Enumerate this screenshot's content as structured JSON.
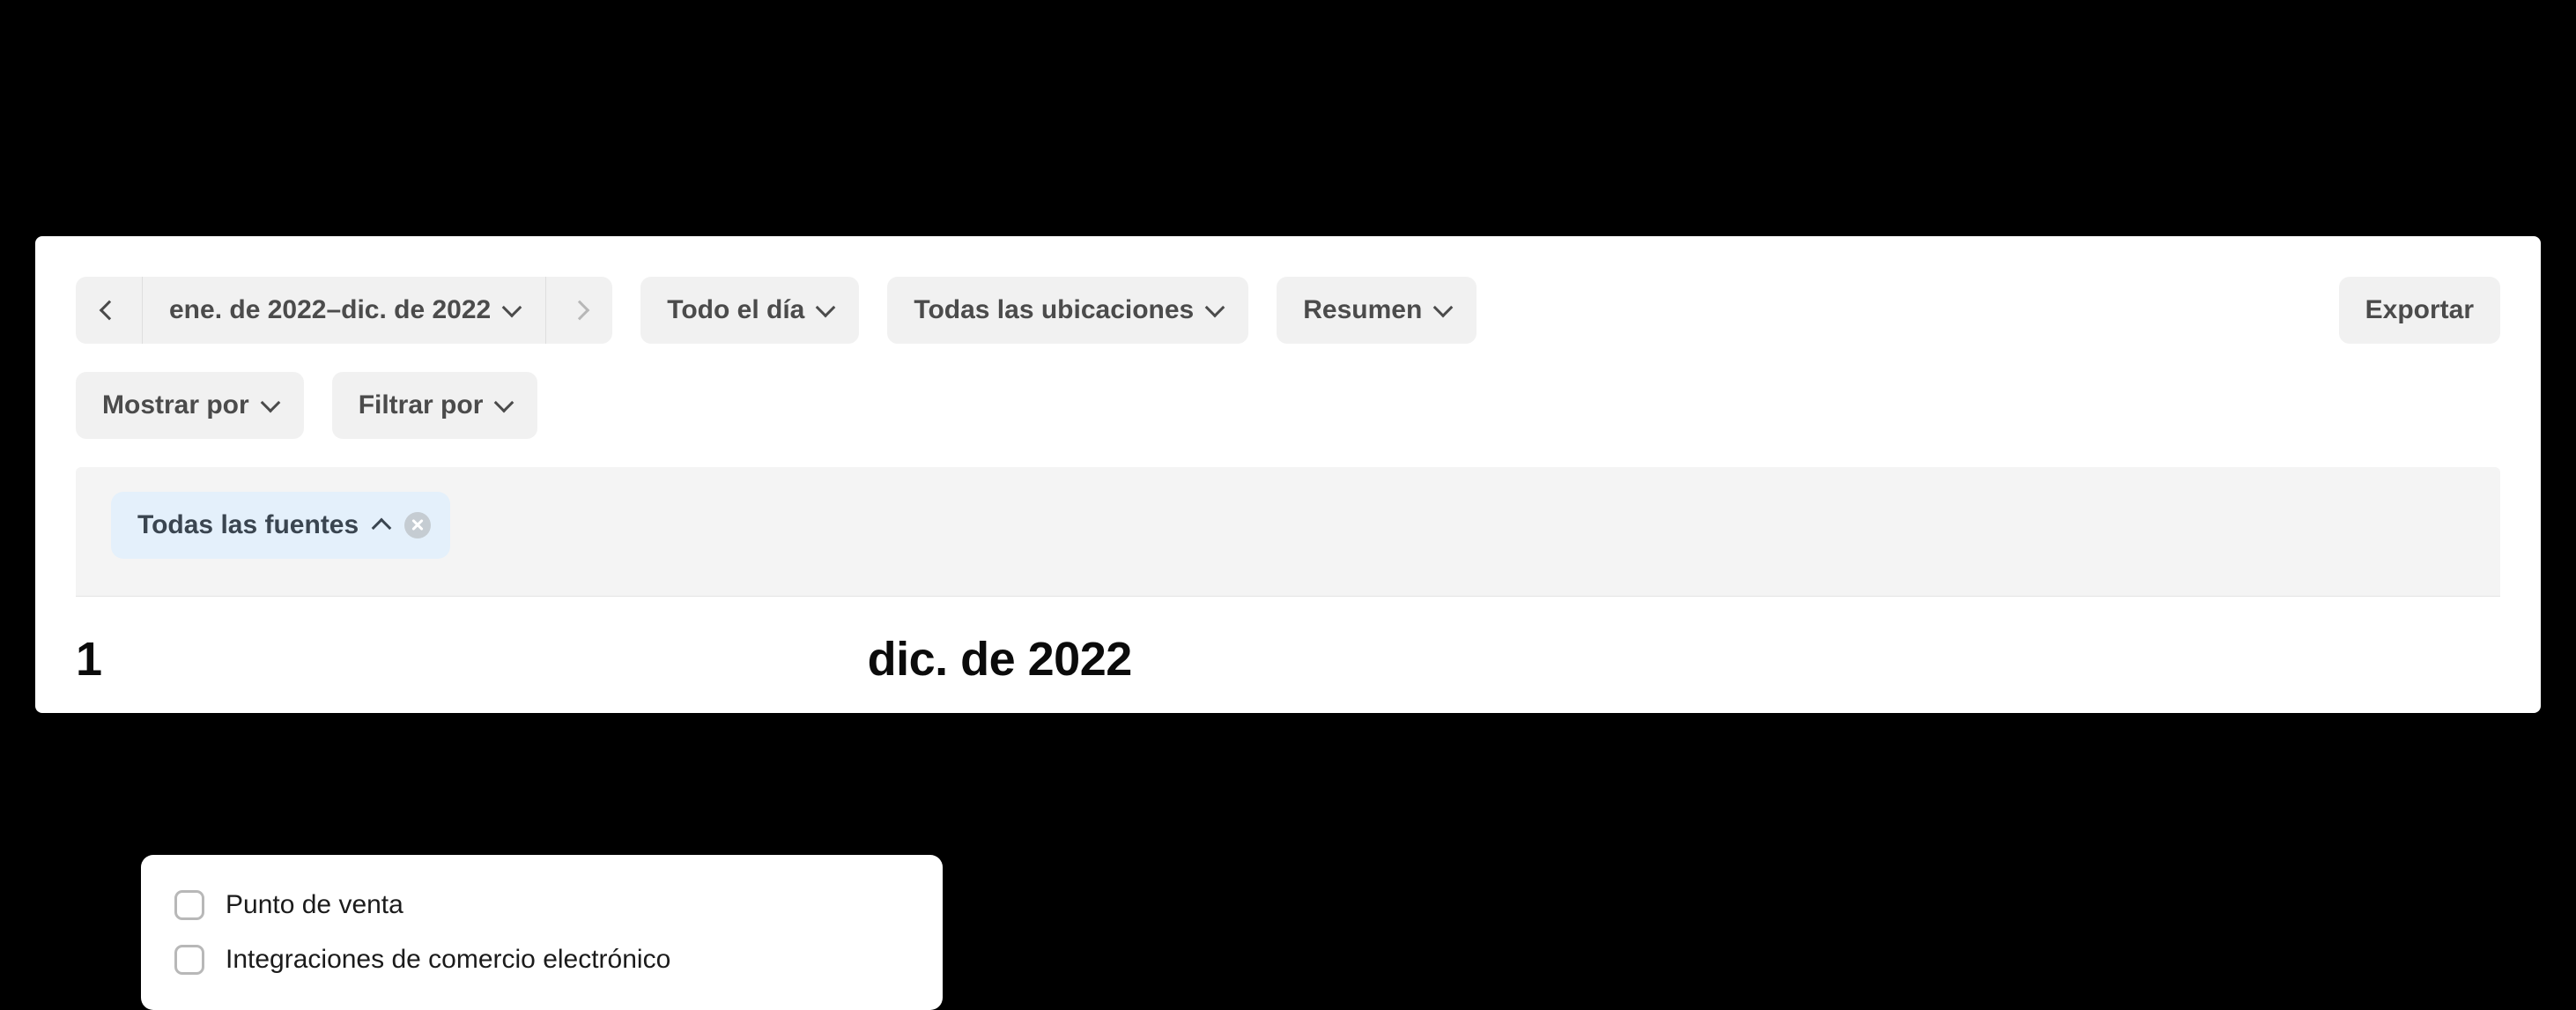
{
  "filters": {
    "date_range": "ene. de 2022–dic. de 2022",
    "time": "Todo el día",
    "locations": "Todas las ubicaciones",
    "view": "Resumen",
    "export": "Exportar",
    "show_by": "Mostrar por",
    "filter_by": "Filtrar por"
  },
  "active_filter": {
    "label": "Todas las fuentes"
  },
  "dropdown": {
    "options": [
      "Punto de venta",
      "Integraciones de comercio electrónico"
    ]
  },
  "heading_prefix": "1",
  "heading_suffix": "dic. de 2022"
}
